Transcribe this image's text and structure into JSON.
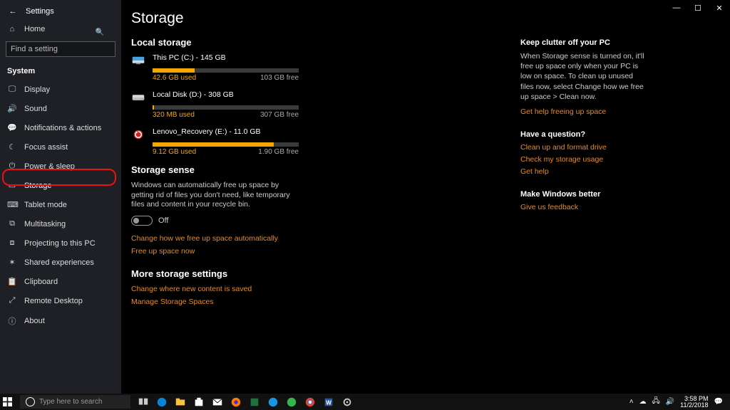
{
  "titlebar": {
    "app_name": "Settings"
  },
  "sidebar": {
    "home_label": "Home",
    "search_placeholder": "Find a setting",
    "section_label": "System",
    "items": [
      {
        "icon": "🖵",
        "label": "Display"
      },
      {
        "icon": "🔊",
        "label": "Sound"
      },
      {
        "icon": "💬",
        "label": "Notifications & actions"
      },
      {
        "icon": "☾",
        "label": "Focus assist"
      },
      {
        "icon": "⏻",
        "label": "Power & sleep"
      },
      {
        "icon": "▭",
        "label": "Storage"
      },
      {
        "icon": "⌨",
        "label": "Tablet mode"
      },
      {
        "icon": "⧉",
        "label": "Multitasking"
      },
      {
        "icon": "⧈",
        "label": "Projecting to this PC"
      },
      {
        "icon": "✶",
        "label": "Shared experiences"
      },
      {
        "icon": "📋",
        "label": "Clipboard"
      },
      {
        "icon": "⤢",
        "label": "Remote Desktop"
      },
      {
        "icon": "ⓘ",
        "label": "About"
      }
    ]
  },
  "page": {
    "title": "Storage",
    "local_storage_heading": "Local storage",
    "drives": [
      {
        "name": "This PC (C:) - 145 GB",
        "used_label": "42.6 GB used",
        "free_label": "103 GB free",
        "fill_pct": 29,
        "icon": "pc"
      },
      {
        "name": "Local Disk (D:) - 308 GB",
        "used_label": "320 MB used",
        "free_label": "307 GB free",
        "fill_pct": 1,
        "icon": "hdd"
      },
      {
        "name": "Lenovo_Recovery (E:) - 11.0 GB",
        "used_label": "9.12 GB used",
        "free_label": "1.90 GB free",
        "fill_pct": 83,
        "icon": "recovery"
      }
    ],
    "sense_heading": "Storage sense",
    "sense_desc": "Windows can automatically free up space by getting rid of files you don't need, like temporary files and content in your recycle bin.",
    "toggle_label": "Off",
    "sense_links": [
      "Change how we free up space automatically",
      "Free up space now"
    ],
    "more_heading": "More storage settings",
    "more_links": [
      "Change where new content is saved",
      "Manage Storage Spaces"
    ]
  },
  "tips": {
    "blocks": [
      {
        "title": "Keep clutter off your PC",
        "text": "When Storage sense is turned on, it'll free up space only when your PC is low on space. To clean up unused files now, select Change how we free up space > Clean now.",
        "links": [
          "Get help freeing up space"
        ]
      },
      {
        "title": "Have a question?",
        "text": "",
        "links": [
          "Clean up and format drive",
          "Check my storage usage",
          "Get help"
        ]
      },
      {
        "title": "Make Windows better",
        "text": "",
        "links": [
          "Give us feedback"
        ]
      }
    ]
  },
  "taskbar": {
    "search_placeholder": "Type here to search",
    "time": "3:58 PM",
    "date": "11/2/2018"
  }
}
